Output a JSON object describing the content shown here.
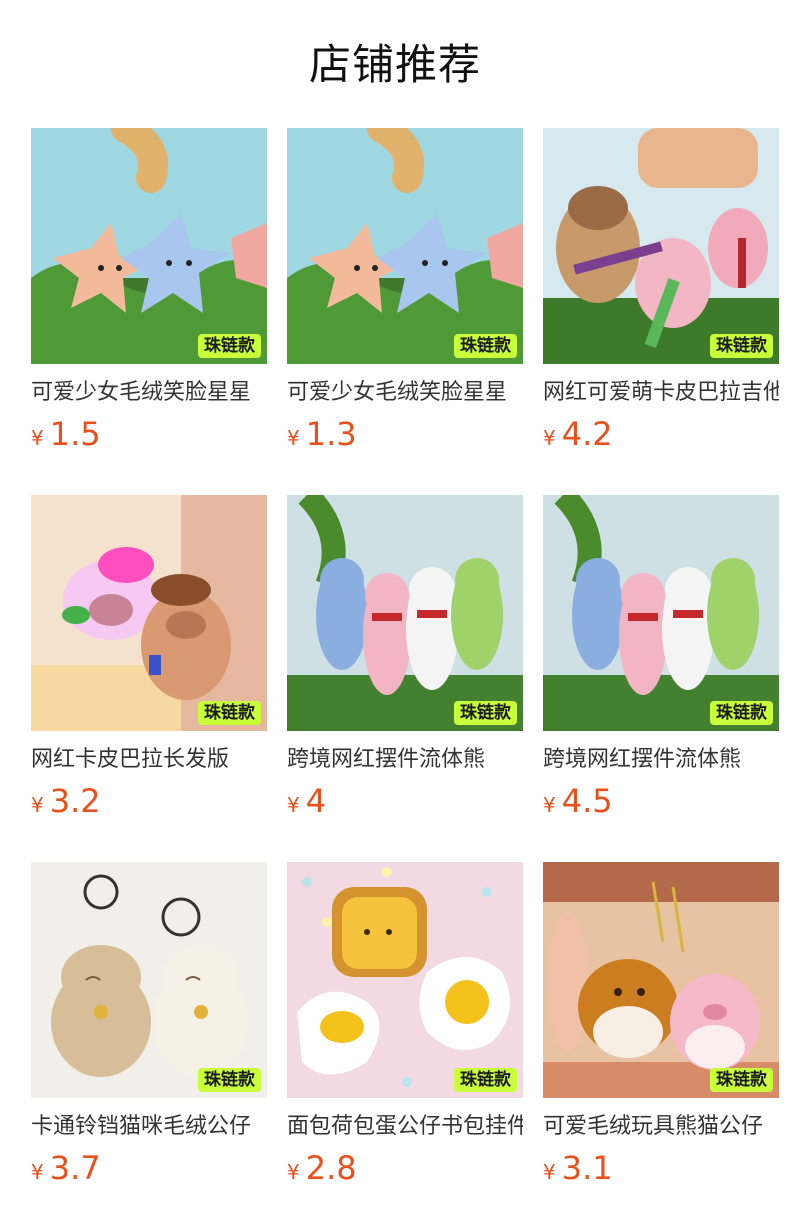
{
  "page": {
    "title": "店铺推荐"
  },
  "currency_symbol": "¥",
  "badge_text": "珠链款",
  "colors": {
    "price": "#e8501c",
    "badge_bg": "#c8ff3a"
  },
  "products": [
    {
      "name": "可爱少女毛绒笑脸星星",
      "price": "1.5",
      "image": "star-plush-keychain",
      "badge": true
    },
    {
      "name": "可爱少女毛绒笑脸星星",
      "price": "1.3",
      "image": "star-plush-keychain",
      "badge": true
    },
    {
      "name": "网红可爱萌卡皮巴拉吉他",
      "price": "4.2",
      "image": "capybara-guitar-keychain",
      "badge": true
    },
    {
      "name": "网红卡皮巴拉长发版",
      "price": "3.2",
      "image": "capybara-longhair-keychain",
      "badge": true
    },
    {
      "name": "跨境网红摆件流体熊",
      "price": "4",
      "image": "fluid-bear-keychain",
      "badge": true
    },
    {
      "name": "跨境网红摆件流体熊",
      "price": "4.5",
      "image": "fluid-bear-keychain",
      "badge": true
    },
    {
      "name": "卡通铃铛猫咪毛绒公仔",
      "price": "3.7",
      "image": "bell-cat-plush",
      "badge": true
    },
    {
      "name": "面包荷包蛋公仔书包挂件",
      "price": "2.8",
      "image": "toast-egg-plush",
      "badge": true
    },
    {
      "name": "可爱毛绒玩具熊猫公仔",
      "price": "3.1",
      "image": "bear-pig-plush",
      "badge": true
    }
  ]
}
